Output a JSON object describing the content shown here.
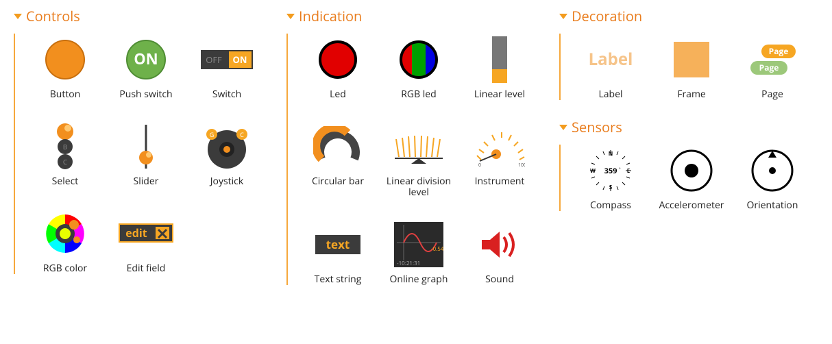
{
  "groups": {
    "controls": {
      "title": "Controls",
      "items": [
        {
          "label": "Button"
        },
        {
          "label": "Push switch"
        },
        {
          "label": "Switch"
        },
        {
          "label": "Select"
        },
        {
          "label": "Slider"
        },
        {
          "label": "Joystick"
        },
        {
          "label": "RGB color"
        },
        {
          "label": "Edit field"
        }
      ]
    },
    "indication": {
      "title": "Indication",
      "items": [
        {
          "label": "Led"
        },
        {
          "label": "RGB led"
        },
        {
          "label": "Linear level"
        },
        {
          "label": "Circular bar"
        },
        {
          "label": "Linear division level"
        },
        {
          "label": "Instrument"
        },
        {
          "label": "Text string"
        },
        {
          "label": "Online graph"
        },
        {
          "label": "Sound"
        }
      ]
    },
    "decoration": {
      "title": "Decoration",
      "items": [
        {
          "label": "Label"
        },
        {
          "label": "Frame"
        },
        {
          "label": "Page"
        }
      ]
    },
    "sensors": {
      "title": "Sensors",
      "items": [
        {
          "label": "Compass"
        },
        {
          "label": "Accelerometer"
        },
        {
          "label": "Orientation"
        }
      ]
    }
  },
  "decoration_label_text": "Label",
  "decoration_page_text": "Page",
  "switch_off": "OFF",
  "switch_on": "ON",
  "push_on": "ON",
  "edit_text": "edit",
  "text_string_text": "text",
  "compass_deg": "359",
  "colors": {
    "accent": "#f28c1d",
    "green": "#6eb14a"
  }
}
